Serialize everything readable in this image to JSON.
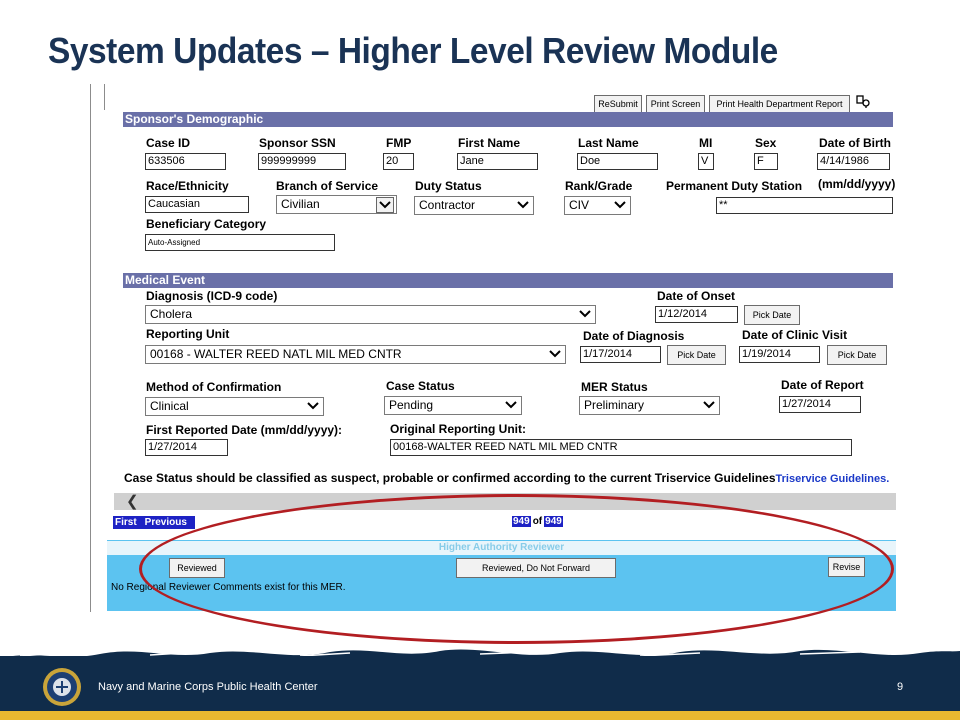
{
  "slide": {
    "title": "System Updates – Higher Level Review Module",
    "footer_org": "Navy and Marine Corps Public Health Center",
    "page_number": "9"
  },
  "toolbar": {
    "resubmit": "ReSubmit",
    "print_screen": "Print Screen",
    "print_health_report": "Print Health Department Report"
  },
  "sponsor": {
    "section_title": "Sponsor's Demographic",
    "case_id_label": "Case ID",
    "case_id_value": "633506",
    "ssn_label": "Sponsor SSN",
    "ssn_value": "999999999",
    "fmp_label": "FMP",
    "fmp_value": "20",
    "first_name_label": "First Name",
    "first_name_value": "Jane",
    "last_name_label": "Last Name",
    "last_name_value": "Doe",
    "mi_label": "MI",
    "mi_value": "V",
    "sex_label": "Sex",
    "sex_value": "F",
    "dob_label": "Date of Birth",
    "dob_value": "4/14/1986",
    "dob_format": "(mm/dd/yyyy)",
    "race_label": "Race/Ethnicity",
    "race_value": "Caucasian",
    "branch_label": "Branch of Service",
    "branch_value": "Civilian",
    "duty_status_label": "Duty Status",
    "duty_status_value": "Contractor",
    "rank_label": "Rank/Grade",
    "rank_value": "CIV",
    "pds_label": "Permanent Duty Station",
    "pds_value": "**",
    "beneficiary_label": "Beneficiary Category",
    "beneficiary_value": "Auto-Assigned"
  },
  "medical": {
    "section_title": "Medical Event",
    "diagnosis_label": "Diagnosis (ICD-9 code)",
    "diagnosis_value": "Cholera",
    "onset_label": "Date of Onset",
    "onset_value": "1/12/2014",
    "reporting_unit_label": "Reporting Unit",
    "reporting_unit_value": "00168 - WALTER REED NATL MIL MED CNTR",
    "diagnosis_date_label": "Date of Diagnosis",
    "diagnosis_date_value": "1/17/2014",
    "clinic_visit_label": "Date of Clinic Visit",
    "clinic_visit_value": "1/19/2014",
    "pick_date": "Pick Date",
    "confirmation_label": "Method of Confirmation",
    "confirmation_value": "Clinical",
    "case_status_label": "Case Status",
    "case_status_value": "Pending",
    "mer_status_label": "MER Status",
    "mer_status_value": "Preliminary",
    "report_date_label": "Date of Report",
    "report_date_value": "1/27/2014",
    "first_reported_label": "First Reported Date (mm/dd/yyyy):",
    "first_reported_value": "1/27/2014",
    "original_unit_label": "Original Reporting Unit:",
    "original_unit_value": "00168-WALTER REED NATL MIL MED CNTR",
    "notice_text": "Case Status should be classified as suspect, probable or confirmed according to the current Triservice Guidelines",
    "notice_link": "Triservice Guidelines."
  },
  "navigation": {
    "first": "First",
    "previous": "Previous",
    "current": "949",
    "of": "of",
    "total": "949"
  },
  "review": {
    "header": "Higher Authority Reviewer",
    "reviewed": "Reviewed",
    "reviewed_no_forward": "Reviewed, Do Not Forward",
    "revise": "Revise",
    "comments": "No Regional Reviewer Comments exist for this MER."
  },
  "colors": {
    "title": "#1a3355",
    "section_bar": "#6a70a8",
    "review_panel": "#5cc3f0",
    "highlight_oval": "#b21e22",
    "footer": "#102c4a",
    "footer_accent": "#e9b830"
  }
}
